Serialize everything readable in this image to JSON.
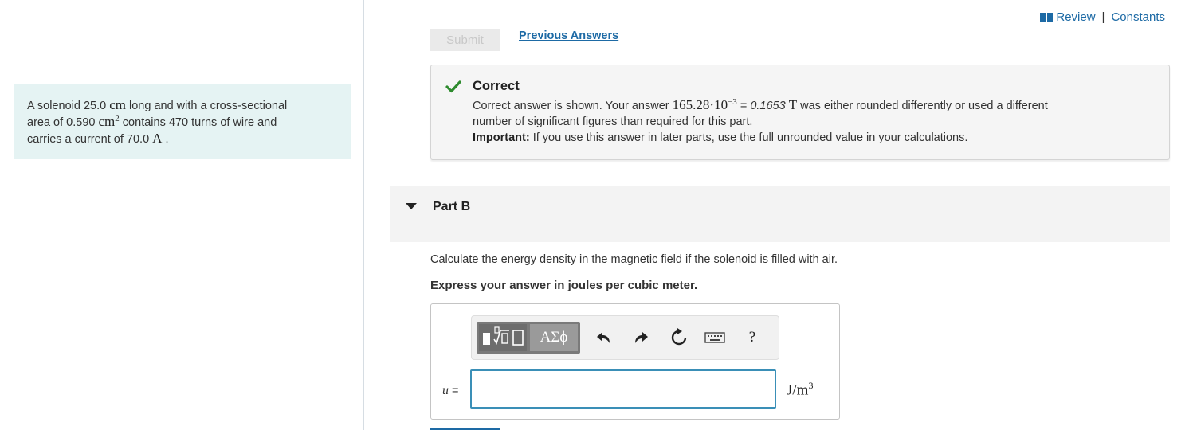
{
  "problem": {
    "line1_pre": "A solenoid 25.0 ",
    "line1_unit": "cm",
    "line1_post": " long and with a cross-sectional",
    "line2_pre": "area of 0.590 ",
    "line2_unit": "cm",
    "line2_exp": "2",
    "line2_post": " contains 470 turns of wire and",
    "line3_pre": "carries a current of 70.0 ",
    "line3_unit": "A",
    "line3_post": " ."
  },
  "topnav": {
    "review": "Review",
    "separator": "|",
    "constants": "Constants"
  },
  "submission": {
    "submit_label": "Submit",
    "previous_answers": "Previous Answers"
  },
  "feedback": {
    "title": "Correct",
    "line1_pre": "Correct answer is shown. Your answer ",
    "answer_mantissa": "165.28·10",
    "answer_exp": "−3",
    "equals": " = ",
    "rounded": "0.1653",
    "unit": "T",
    "line1_post": " was either rounded differently or used a different",
    "line2": "number of significant figures than required for this part.",
    "important_label": "Important:",
    "important_text": " If you use this answer in later parts, use the full unrounded value in your calculations."
  },
  "part_b": {
    "title": "Part B",
    "question": "Calculate the energy density in the magnetic field if the solenoid is filled with air.",
    "instruction": "Express your answer in joules per cubic meter."
  },
  "answer": {
    "variable": "u",
    "equals": " =",
    "value": "",
    "unit_base": "J/m",
    "unit_exp": "3"
  },
  "toolbar": {
    "greek_label": "ΑΣϕ",
    "help_label": "?",
    "icons": [
      "templates-icon",
      "greek-symbols-icon",
      "undo-icon",
      "redo-icon",
      "reset-icon",
      "keyboard-icon",
      "help-icon"
    ]
  },
  "colors": {
    "link": "#1d6aa5",
    "problem_bg": "#e5f3f3",
    "correct_green": "#2e8b2e",
    "input_border": "#3a8fb7"
  }
}
